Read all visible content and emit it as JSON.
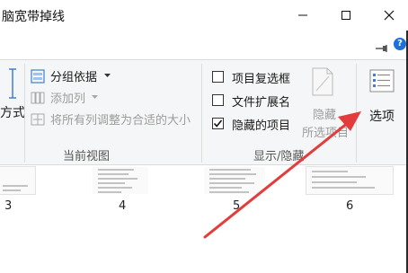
{
  "window": {
    "title": "脑宽带掉线",
    "minimize_glyph": "—",
    "maximize_glyph": "☐",
    "close_glyph": "✕"
  },
  "ribbon": {
    "layout_group": {
      "fangshi_label": "方式"
    },
    "current_view": {
      "group_by_label": "分组依据",
      "add_column_label": "添加列",
      "size_columns_label": "将所有列调整为合适的大小",
      "group_label": "当前视图"
    },
    "show_hide": {
      "item_checkboxes_label": "项目复选框",
      "item_checkboxes_checked": false,
      "file_extensions_label": "文件扩展名",
      "file_extensions_checked": false,
      "hidden_items_label": "隐藏的项目",
      "hidden_items_checked": true,
      "hide_selected_line1": "隐藏",
      "hide_selected_line2": "所选项目",
      "group_label": "显示/隐藏"
    },
    "options": {
      "label": "选项"
    }
  },
  "content": {
    "thumbnails": [
      {
        "number": "3"
      },
      {
        "number": "4"
      },
      {
        "number": "5"
      },
      {
        "number": "6"
      }
    ]
  },
  "colors": {
    "annotation_arrow": "#e23c3c",
    "help_icon": "#1e6fd9",
    "ribbon_bg": "#f5f6f7"
  },
  "icons": [
    "minimize-icon",
    "maximize-icon",
    "close-icon",
    "pin-icon",
    "help-icon",
    "group-by-icon",
    "add-column-icon",
    "size-columns-icon",
    "hide-selected-icon",
    "options-icon",
    "annotation-arrow"
  ]
}
